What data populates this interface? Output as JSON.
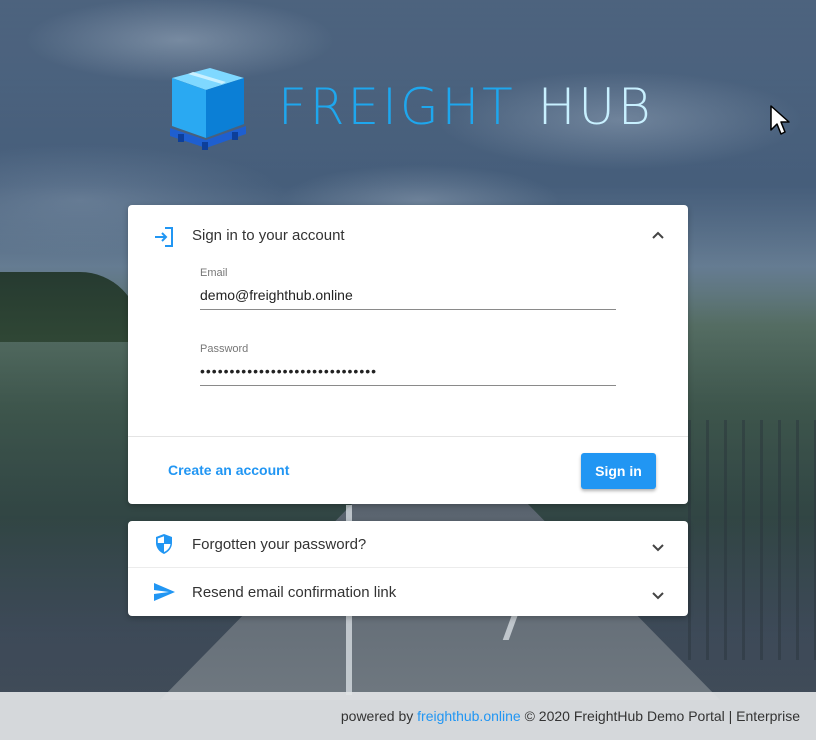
{
  "brand": {
    "name_part1": "FREIGHT",
    "name_part2": "HUB",
    "logo_icon": "package-box-icon",
    "primary_color": "#1ea7ee",
    "secondary_color": "#c8f0ff"
  },
  "signin": {
    "title": "Sign in to your account",
    "header_icon": "login-arrow-icon",
    "collapse_icon": "chevron-up-icon",
    "email_label": "Email",
    "email_value": "demo@freighthub.online",
    "password_label": "Password",
    "password_value": "••••••••••••••••••••••••••••••",
    "create_account_label": "Create an account",
    "signin_button_label": "Sign in"
  },
  "forgot": {
    "title": "Forgotten your password?",
    "icon": "shield-icon",
    "expand_icon": "chevron-down-icon"
  },
  "resend": {
    "title": "Resend email confirmation link",
    "icon": "send-icon",
    "expand_icon": "chevron-down-icon"
  },
  "footer": {
    "prefix": "powered by ",
    "link_text": "freighthub.online",
    "suffix": " © 2020 FreightHub Demo Portal | Enterprise"
  },
  "colors": {
    "accent": "#2196f3"
  }
}
